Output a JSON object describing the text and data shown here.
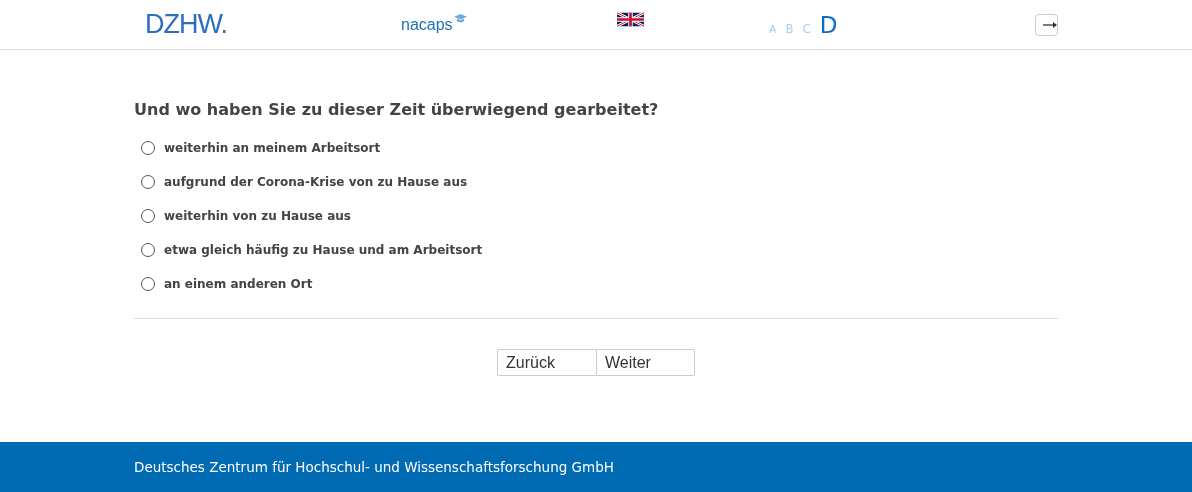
{
  "header": {
    "logo": "DZHW.",
    "partner_logo": "nacaps",
    "font_sizes": [
      {
        "label": "A",
        "selected": false
      },
      {
        "label": "B",
        "selected": false
      },
      {
        "label": "C",
        "selected": false
      },
      {
        "label": "D",
        "selected": true
      }
    ]
  },
  "question": "Und wo haben Sie zu dieser Zeit überwiegend gearbeitet?",
  "options": [
    {
      "label": "weiterhin an meinem Arbeitsort",
      "selected": false
    },
    {
      "label": "aufgrund der Corona-Krise von zu Hause aus",
      "selected": false
    },
    {
      "label": "weiterhin von zu Hause aus",
      "selected": false
    },
    {
      "label": "etwa gleich häufig zu Hause und am Arbeitsort",
      "selected": false
    },
    {
      "label": "an einem anderen Ort",
      "selected": false
    }
  ],
  "buttons": [
    "Zurück",
    "Weiter"
  ],
  "footer": "Deutsches Zentrum für Hochschul- und Wissenschaftsforschung GmbH"
}
